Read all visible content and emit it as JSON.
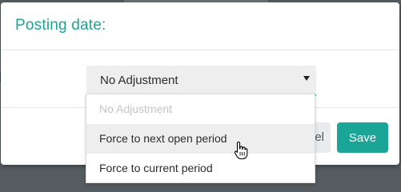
{
  "dialog": {
    "title": "Posting date:",
    "select": {
      "value": "No Adjustment",
      "options": [
        {
          "label": "No Adjustment",
          "disabled": true
        },
        {
          "label": "Force to next open period",
          "hovered": true
        },
        {
          "label": "Force to current period"
        }
      ]
    },
    "cancel_label": "el",
    "save_label": "Save"
  },
  "colors": {
    "accent": "#1aa597",
    "overlay": "#555b5e"
  }
}
